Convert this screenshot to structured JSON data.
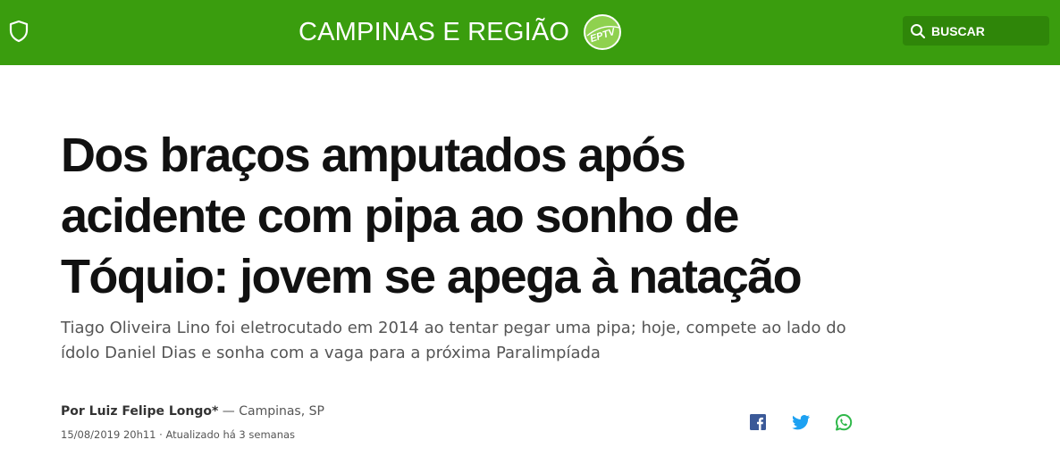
{
  "header": {
    "background_color": "#3a9d0e",
    "title": "CAMPINAS E REGIÃO",
    "logo_text": "EPTV",
    "search_label": "BUSCAR",
    "icons": [
      "shield-icon",
      "search-icon"
    ]
  },
  "article": {
    "headline": "Dos braços amputados após acidente com pipa ao sonho de Tóquio: jovem se apega à natação",
    "subtitle": "Tiago Oliveira Lino foi eletrocutado em 2014 ao tentar pegar uma pipa; hoje, compete ao lado do ídolo Daniel Dias e sonha com a vaga para a próxima Paralimpíada",
    "author": "Por Luiz Felipe Longo*",
    "location": "— Campinas, SP",
    "published": "15/08/2019 20h11",
    "separator": "·",
    "updated": "Atualizado há 3 semanas"
  },
  "share": {
    "icons": [
      "facebook-icon",
      "twitter-icon",
      "whatsapp-icon"
    ],
    "colors": {
      "facebook": "#3b5998",
      "twitter": "#1da1f2",
      "whatsapp": "#2fb84a"
    }
  }
}
